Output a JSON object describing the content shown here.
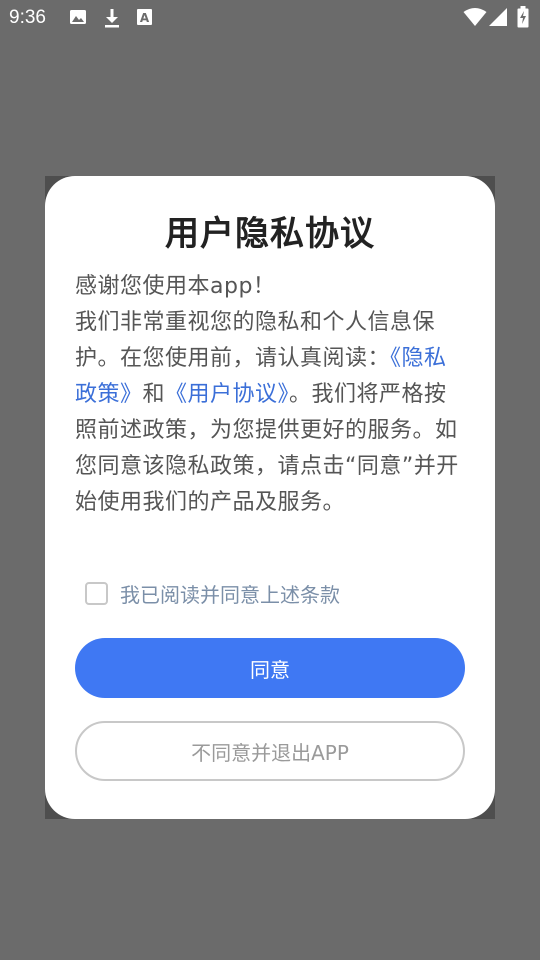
{
  "status_bar": {
    "time": "9:36",
    "left_icons": [
      "image-icon",
      "download-icon",
      "text-a-icon"
    ],
    "right_icons": [
      "wifi-icon",
      "signal-icon",
      "battery-icon"
    ]
  },
  "dialog": {
    "title": "用户隐私协议",
    "body": {
      "line1": "感谢您使用本app！",
      "part1": "我们非常重视您的隐私和个人信息保护。在您使用前，请认真阅读：",
      "privacy_link": "《隐私政策》",
      "and": "和",
      "user_link": "《用户协议》",
      "part2": "。我们将严格按照前述政策，为您提供更好的服务。如您同意该隐私政策，请点击“同意”并开始使用我们的产品及服务。"
    },
    "consent_label": "我已阅读并同意上述条款",
    "consent_checked": false,
    "agree_button": "同意",
    "disagree_button": "不同意并退出APP",
    "colors": {
      "overlay": "#6b6b6b",
      "primary": "#3f78f3",
      "link": "#3b6fd8"
    }
  }
}
